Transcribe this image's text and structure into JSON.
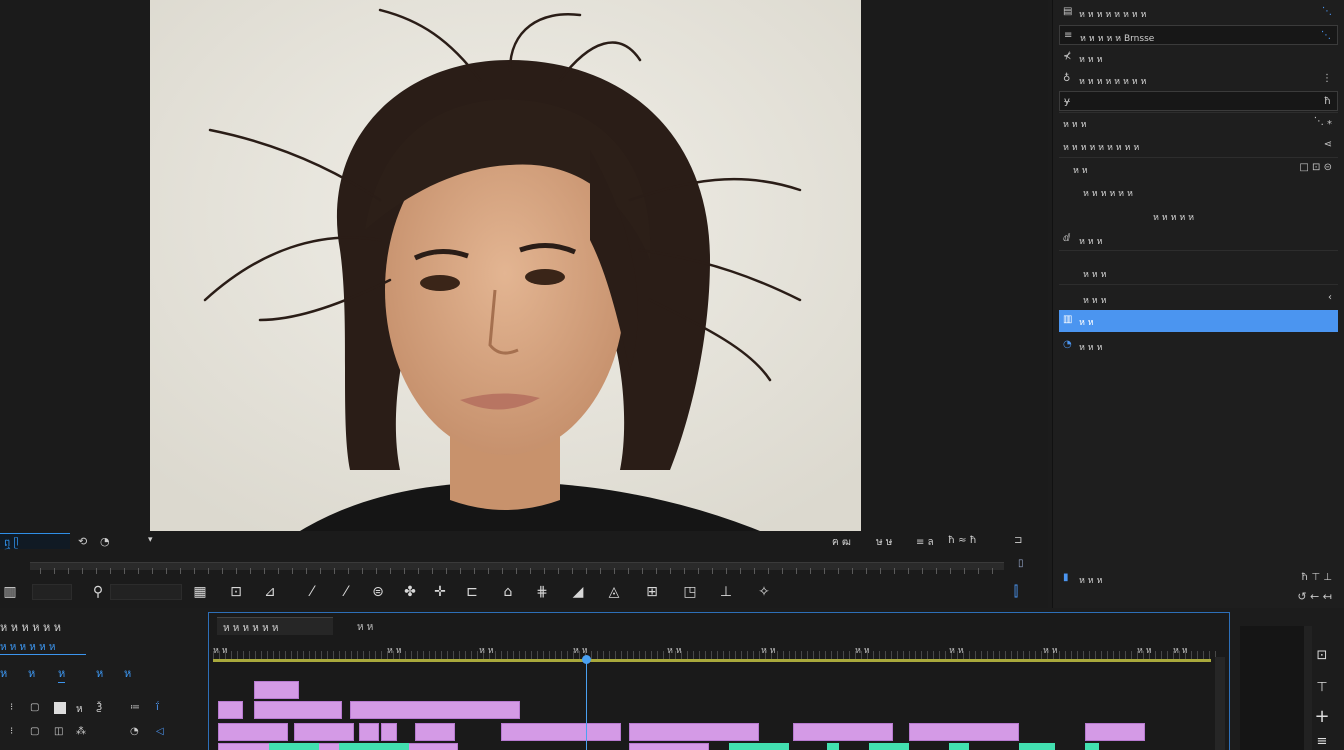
{
  "transport": {
    "timecode": "ឮ ᥫ",
    "controls": [
      "⟲",
      "◔",
      "▾"
    ],
    "right_labels": [
      "ฅ ฒ",
      "ษ ษ",
      "≡ ล",
      "ħ ≈ ħ",
      "⊐"
    ]
  },
  "toolbar": {
    "tools": [
      "▥",
      "⚲",
      "▦",
      "⊡",
      "⊿",
      "⁄",
      "⁄",
      "⊜",
      "✤",
      "✛",
      "⊏",
      "⌂",
      "⋕",
      "◢",
      "◬",
      "⊞",
      "◳",
      "⊥",
      "✧"
    ]
  },
  "right_panel": {
    "header": {
      "label": "ห ห ห ห ห ห ห ห",
      "icon": "⋱"
    },
    "search": {
      "label": "ห ห ห ห ห  Brnsse",
      "icon": "⋱"
    },
    "rows": [
      {
        "label": "ห ห ห",
        "icon": "⊀",
        "right": ""
      },
      {
        "label": "ห ห ห ห ห ห ห ห",
        "icon": "♁",
        "right": "⋮"
      },
      {
        "label": "",
        "icon": "ɏ",
        "right": "ħ"
      },
      {
        "label": "ห ห ห",
        "icon": "",
        "right": "⋱ ⁎"
      },
      {
        "label": "ห ห ห ห ห  ห ห ห ห",
        "icon": "",
        "right": "⋖"
      },
      {
        "label": "ห ห",
        "icon": "",
        "right": "□ ⊡ ⊝"
      },
      {
        "label": "ห ห ห ห ห ห",
        "icon": "",
        "right": ""
      },
      {
        "label": "ห ห ห ห ห",
        "icon": "",
        "right": ""
      },
      {
        "label": "ห ห ห",
        "icon": "ⅆ",
        "right": ""
      },
      {
        "label": "ห ห ห",
        "icon": "",
        "right": ""
      },
      {
        "label": "ห ห ห",
        "icon": "",
        "right": "‹"
      },
      {
        "label": "ห ห",
        "icon": "▥",
        "right": ""
      },
      {
        "label": "ห ห ห",
        "icon": "◔",
        "right": ""
      }
    ],
    "footer": {
      "label": "ห ห ห",
      "icons": "ħ  ⊤  ⊥",
      "bottom_icons": "↺  ←  ↤"
    }
  },
  "bottom_left": {
    "title": "ห ห ห ห ห ห",
    "subtitle": "ห ห ห ห ห ห",
    "tabs": [
      "ห",
      "ห",
      "ห",
      "ห",
      "ห"
    ],
    "controls": [
      "⁝",
      "▢",
      "ห",
      "Ѯ",
      "≔",
      "ḯ",
      "◫",
      "⁂",
      "◔",
      "◁"
    ]
  },
  "timeline": {
    "tab_active": "ห ห ห  ห ห ห",
    "tab_other": "ห ห",
    "ruler_labels": [
      "ห ห",
      "ห ห",
      "ห ห",
      "ห ห",
      "ห ห",
      "ห ห",
      "ห ห",
      "ห ห",
      "ห ห",
      "ห ห",
      "ห ห"
    ]
  },
  "right_strip": {
    "icons": [
      "⊡",
      "⊤",
      "+",
      "≡"
    ]
  },
  "colors": {
    "accent": "#4b95f0",
    "video_clip": "#d49ae6",
    "audio_clip": "#42e0b0",
    "workarea": "#a9a93c"
  }
}
